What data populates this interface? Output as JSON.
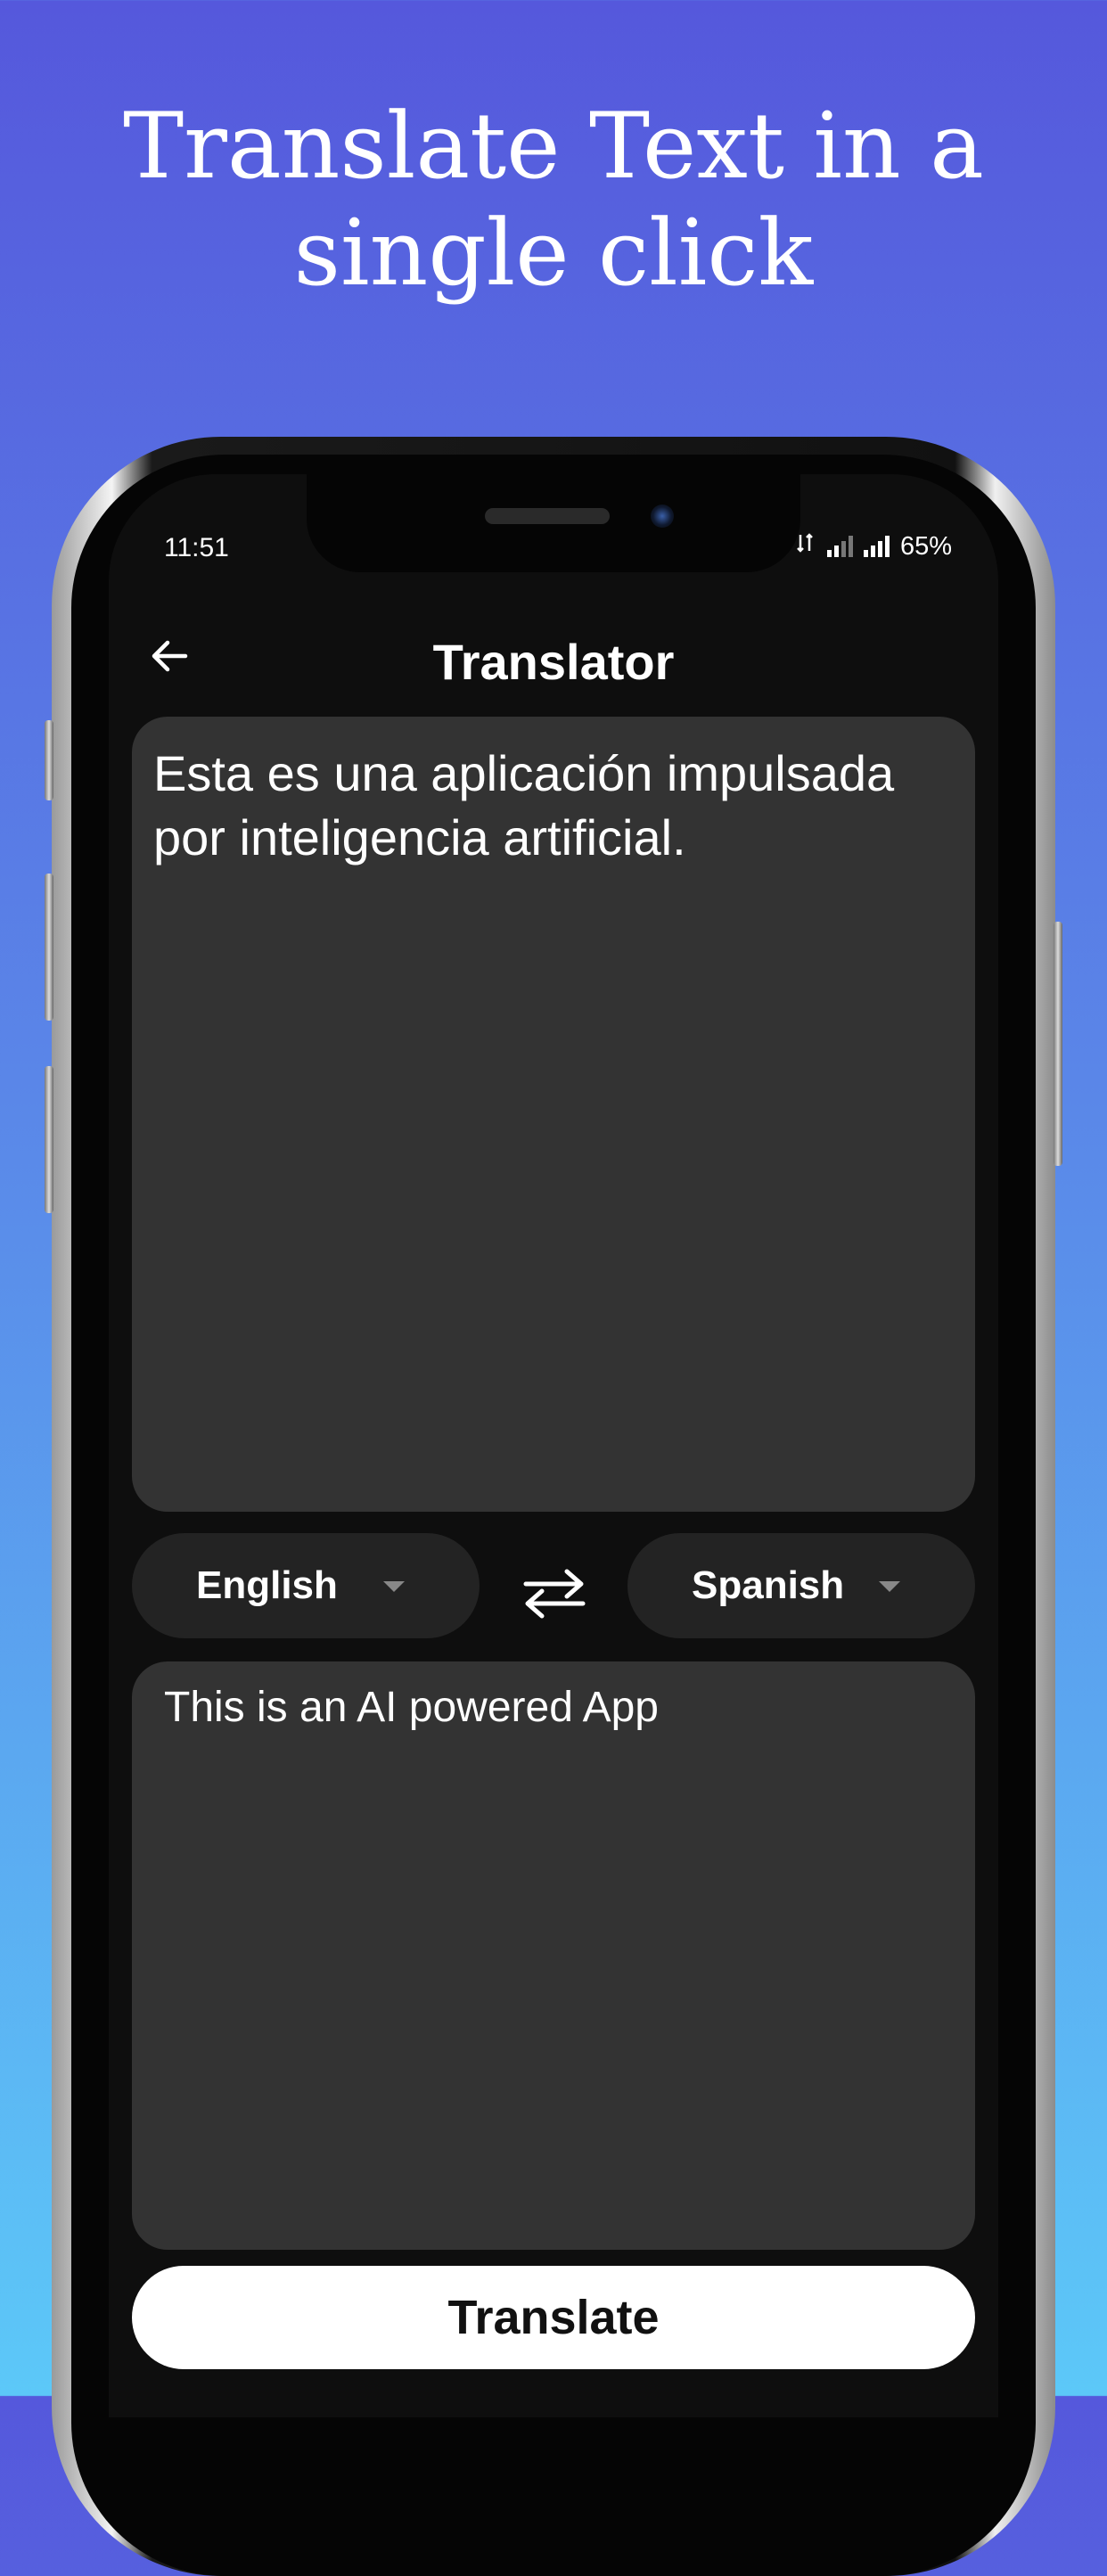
{
  "promo": {
    "headline_line1": "Translate Text in a",
    "headline_line2": "single click"
  },
  "status_bar": {
    "time": "11:51",
    "battery": "65%",
    "icons": [
      "data-icon",
      "signal-icon",
      "signal-icon"
    ]
  },
  "app_bar": {
    "title": "Translator",
    "back_icon": "arrow-left-icon"
  },
  "source": {
    "text": "Esta es una aplicación impulsada por inteligencia artificial."
  },
  "languages": {
    "from": "English",
    "to": "Spanish",
    "swap_icon": "swap-arrows-icon"
  },
  "target": {
    "text": "This is an AI powered App"
  },
  "actions": {
    "translate_label": "Translate"
  },
  "colors": {
    "background_top": "#5558dc",
    "background_bottom": "#5cc8f8",
    "screen": "#0e0e0e",
    "panel": "#333333",
    "pill": "#232323",
    "button": "#ffffff"
  }
}
